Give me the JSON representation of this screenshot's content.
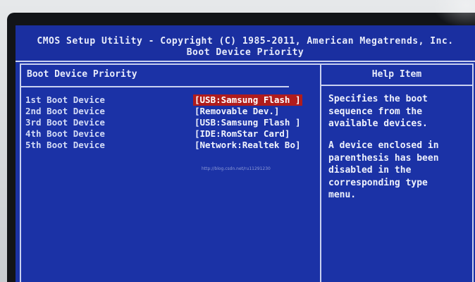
{
  "title": {
    "line1": "CMOS Setup Utility - Copyright (C) 1985-2011, American Megatrends, Inc.",
    "line2": "Boot Device Priority"
  },
  "main": {
    "header": "Boot Device Priority",
    "rows": [
      {
        "label": "1st Boot Device",
        "value": "[USB:Samsung Flash ]"
      },
      {
        "label": "2nd Boot Device",
        "value": "[Removable Dev.]"
      },
      {
        "label": "3rd Boot Device",
        "value": "[USB:Samsung Flash ]"
      },
      {
        "label": "4th Boot Device",
        "value": "[IDE:RomStar Card]"
      },
      {
        "label": "5th Boot Device",
        "value": "[Network:Realtek Bo]"
      }
    ],
    "selected_index": 0
  },
  "help": {
    "header": "Help Item",
    "para1": "Specifies the boot\nsequence from the\navailable devices.",
    "para2": "A device enclosed in\nparenthesis has been\ndisabled in the\ncorresponding type\nmenu."
  },
  "watermark": "http://blog.csdn.net/ru11291230",
  "colors": {
    "background": "#1b32a6",
    "text": "#d8dff7",
    "selection": "#b01c1c",
    "border": "#c9d1f0"
  }
}
